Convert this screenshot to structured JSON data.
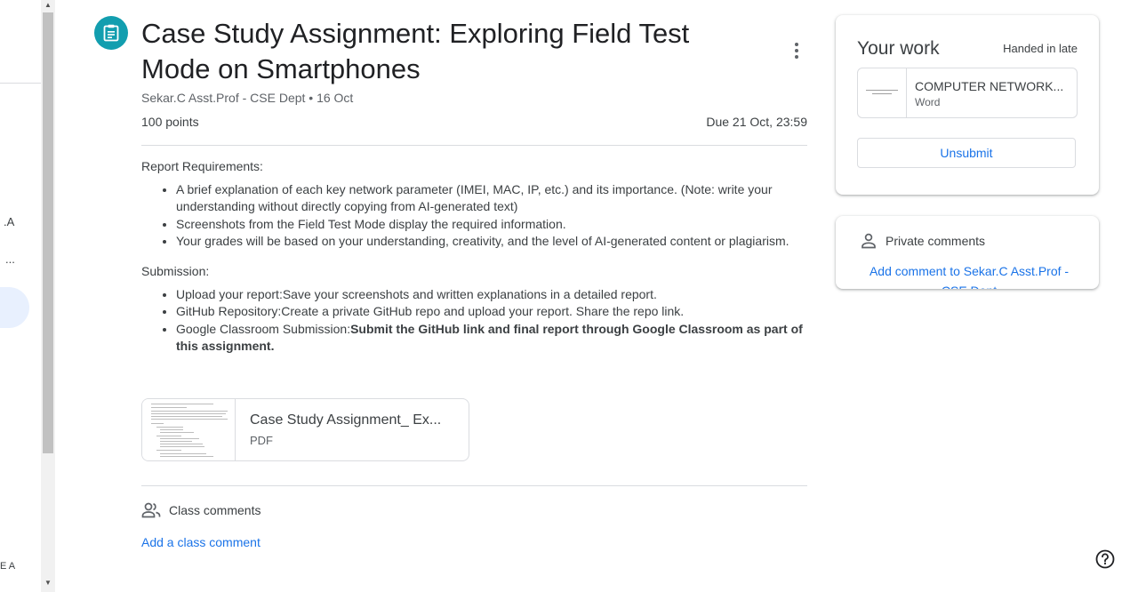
{
  "sidebar": {
    "fragments": [
      ".A",
      "...",
      "E A"
    ]
  },
  "assignment": {
    "title": "Case Study Assignment: Exploring Field Test Mode on Smartphones",
    "byline": "Sekar.C Asst.Prof - CSE Dept • 16 Oct",
    "points": "100 points",
    "due": "Due 21 Oct, 23:59",
    "icon": "assignment-icon",
    "accent_color": "#129eaf"
  },
  "description": {
    "report_heading": "Report Requirements:",
    "report_items": [
      "A brief explanation of each key network parameter (IMEI, MAC, IP, etc.) and its importance. (Note: write your understanding without directly copying from AI-generated text)",
      "Screenshots from the Field Test Mode display the required information.",
      "Your grades will be based on your understanding, creativity, and the level of AI-generated content or plagiarism."
    ],
    "submission_heading": "Submission:",
    "submission_items": [
      "Upload your report:Save your screenshots and written explanations in a detailed report.",
      "GitHub Repository:Create a private GitHub repo and upload your report. Share the repo link."
    ],
    "submission_item3_plain": "Google Classroom Submission:",
    "submission_item3_bold": "Submit the GitHub link and final report through Google Classroom as part of this assignment."
  },
  "attachment": {
    "title": "Case Study Assignment_ Ex...",
    "type": "PDF"
  },
  "class_comments": {
    "heading": "Class comments",
    "add_label": "Add a class comment",
    "icon": "people-icon"
  },
  "your_work": {
    "title": "Your work",
    "status": "Handed in late",
    "file_name": "COMPUTER NETWORK...",
    "file_type": "Word",
    "unsubmit_label": "Unsubmit"
  },
  "private_comments": {
    "heading": "Private comments",
    "add_label": "Add comment to Sekar.C Asst.Prof - CSE Dept",
    "icon": "person-icon"
  },
  "colors": {
    "link": "#1a73e8",
    "text": "#3c4043",
    "divider": "#dadce0"
  }
}
